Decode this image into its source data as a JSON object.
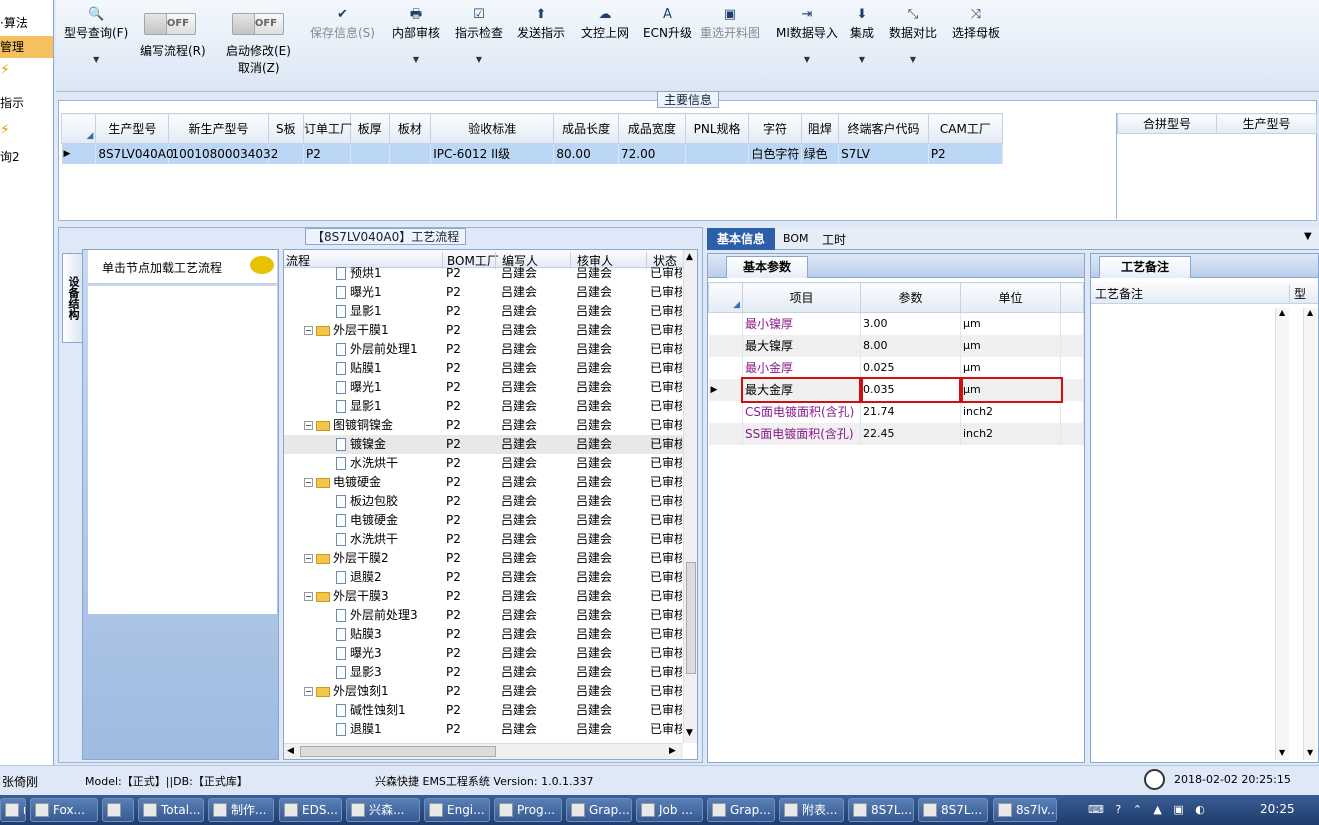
{
  "leftnav": {
    "items": [
      "·算法",
      "管理",
      "指示",
      "询2"
    ]
  },
  "toolbar": {
    "type_query": "型号查询(F)",
    "write_flow": "编写流程(R)",
    "start_modify": "启动修改(E)",
    "cancel": "取消(Z)",
    "toggle_off": "OFF",
    "save": "保存信息(S)",
    "internal_review": "内部审核",
    "instruction_check": "指示检查",
    "send_instruction": "发送指示",
    "upload": "文控上网",
    "ecn": "ECN升级",
    "reselect": "重选开料图",
    "mi_import": "MI数据导入",
    "integrate": "集成",
    "compare": "数据对比",
    "select_master": "选择母板"
  },
  "main_info": {
    "title": "主要信息",
    "columns": [
      "生产型号",
      "新生产型号",
      "S板",
      "订单工厂",
      "板厚",
      "板材",
      "验收标准",
      "成品长度",
      "成品宽度",
      "PNL规格",
      "字符",
      "阻焊",
      "终端客户代码",
      "CAM工厂"
    ],
    "row": [
      "8S7LV040A0",
      "10010800034032",
      "",
      "P2",
      "",
      "",
      "IPC-6012 II级",
      "80.00",
      "72.00",
      "",
      "白色字符",
      "绿色",
      "S7LV",
      "P2"
    ],
    "side_columns": [
      "合拼型号",
      "生产型号"
    ]
  },
  "equipment": {
    "tab": "设备结构",
    "hint": "单击节点加载工艺流程"
  },
  "flow": {
    "title": "【8S7LV040A0】工艺流程",
    "columns": [
      "流程",
      "BOM工厂",
      "编写人",
      "核审人",
      "状态"
    ],
    "rows": [
      {
        "name": "预烘1",
        "level": 2,
        "type": "doc",
        "factory": "P2",
        "writer": "吕建会",
        "reviewer": "吕建会",
        "status": "已审核"
      },
      {
        "name": "曝光1",
        "level": 2,
        "type": "doc",
        "factory": "P2",
        "writer": "吕建会",
        "reviewer": "吕建会",
        "status": "已审核"
      },
      {
        "name": "显影1",
        "level": 2,
        "type": "doc",
        "factory": "P2",
        "writer": "吕建会",
        "reviewer": "吕建会",
        "status": "已审核"
      },
      {
        "name": "外层干膜1",
        "level": 1,
        "type": "folder",
        "factory": "P2",
        "writer": "吕建会",
        "reviewer": "吕建会",
        "status": "已审核"
      },
      {
        "name": "外层前处理1",
        "level": 2,
        "type": "doc",
        "factory": "P2",
        "writer": "吕建会",
        "reviewer": "吕建会",
        "status": "已审核"
      },
      {
        "name": "贴膜1",
        "level": 2,
        "type": "doc",
        "factory": "P2",
        "writer": "吕建会",
        "reviewer": "吕建会",
        "status": "已审核"
      },
      {
        "name": "曝光1",
        "level": 2,
        "type": "doc",
        "factory": "P2",
        "writer": "吕建会",
        "reviewer": "吕建会",
        "status": "已审核"
      },
      {
        "name": "显影1",
        "level": 2,
        "type": "doc",
        "factory": "P2",
        "writer": "吕建会",
        "reviewer": "吕建会",
        "status": "已审核"
      },
      {
        "name": "图镀铜镍金",
        "level": 1,
        "type": "folder",
        "factory": "P2",
        "writer": "吕建会",
        "reviewer": "吕建会",
        "status": "已审核"
      },
      {
        "name": "镀镍金",
        "level": 2,
        "type": "doc",
        "factory": "P2",
        "writer": "吕建会",
        "reviewer": "吕建会",
        "status": "已审核",
        "selected": true
      },
      {
        "name": "水洗烘干",
        "level": 2,
        "type": "doc",
        "factory": "P2",
        "writer": "吕建会",
        "reviewer": "吕建会",
        "status": "已审核"
      },
      {
        "name": "电镀硬金",
        "level": 1,
        "type": "folder",
        "factory": "P2",
        "writer": "吕建会",
        "reviewer": "吕建会",
        "status": "已审核"
      },
      {
        "name": "板边包胶",
        "level": 2,
        "type": "doc",
        "factory": "P2",
        "writer": "吕建会",
        "reviewer": "吕建会",
        "status": "已审核"
      },
      {
        "name": "电镀硬金",
        "level": 2,
        "type": "doc",
        "factory": "P2",
        "writer": "吕建会",
        "reviewer": "吕建会",
        "status": "已审核"
      },
      {
        "name": "水洗烘干",
        "level": 2,
        "type": "doc",
        "factory": "P2",
        "writer": "吕建会",
        "reviewer": "吕建会",
        "status": "已审核"
      },
      {
        "name": "外层干膜2",
        "level": 1,
        "type": "folder",
        "factory": "P2",
        "writer": "吕建会",
        "reviewer": "吕建会",
        "status": "已审核"
      },
      {
        "name": "退膜2",
        "level": 2,
        "type": "doc",
        "factory": "P2",
        "writer": "吕建会",
        "reviewer": "吕建会",
        "status": "已审核"
      },
      {
        "name": "外层干膜3",
        "level": 1,
        "type": "folder",
        "factory": "P2",
        "writer": "吕建会",
        "reviewer": "吕建会",
        "status": "已审核"
      },
      {
        "name": "外层前处理3",
        "level": 2,
        "type": "doc",
        "factory": "P2",
        "writer": "吕建会",
        "reviewer": "吕建会",
        "status": "已审核"
      },
      {
        "name": "贴膜3",
        "level": 2,
        "type": "doc",
        "factory": "P2",
        "writer": "吕建会",
        "reviewer": "吕建会",
        "status": "已审核"
      },
      {
        "name": "曝光3",
        "level": 2,
        "type": "doc",
        "factory": "P2",
        "writer": "吕建会",
        "reviewer": "吕建会",
        "status": "已审核"
      },
      {
        "name": "显影3",
        "level": 2,
        "type": "doc",
        "factory": "P2",
        "writer": "吕建会",
        "reviewer": "吕建会",
        "status": "已审核"
      },
      {
        "name": "外层蚀刻1",
        "level": 1,
        "type": "folder",
        "factory": "P2",
        "writer": "吕建会",
        "reviewer": "吕建会",
        "status": "已审核"
      },
      {
        "name": "碱性蚀刻1",
        "level": 2,
        "type": "doc",
        "factory": "P2",
        "writer": "吕建会",
        "reviewer": "吕建会",
        "status": "已审核"
      },
      {
        "name": "退膜1",
        "level": 2,
        "type": "doc",
        "factory": "P2",
        "writer": "吕建会",
        "reviewer": "吕建会",
        "status": "已审核"
      }
    ]
  },
  "tabs": {
    "basic": "基本信息",
    "bom": "BOM",
    "hours": "工时"
  },
  "params": {
    "tab": "基本参数",
    "columns": [
      "项目",
      "参数",
      "单位"
    ],
    "rows": [
      {
        "item": "最小镍厚",
        "value": "3.00",
        "unit": "μm",
        "highlight": true
      },
      {
        "item": "最大镍厚",
        "value": "8.00",
        "unit": "μm",
        "highlight": false
      },
      {
        "item": "最小金厚",
        "value": "0.025",
        "unit": "μm",
        "highlight": true
      },
      {
        "item": "最大金厚",
        "value": "0.035",
        "unit": "μm",
        "highlight": false,
        "current": true
      },
      {
        "item": "CS面电镀面积(含孔)",
        "value": "21.74",
        "unit": "inch2",
        "highlight": true
      },
      {
        "item": "SS面电镀面积(含孔)",
        "value": "22.45",
        "unit": "inch2",
        "highlight": true
      }
    ]
  },
  "remarks": {
    "tab": "工艺备注",
    "col1": "工艺备注",
    "col2": "型"
  },
  "status": {
    "user": "张倚刚",
    "model": "Model:【正式】||DB:【正式库】",
    "system": "兴森快捷 EMS工程系统 Version: 1.0.1.337",
    "datetime": "2018-02-02 20:25:15"
  },
  "taskbar": {
    "items": [
      "ne...",
      "Fox...",
      "",
      "Total...",
      "制作...",
      "EDS...",
      "兴森...",
      "Engi...",
      "Prog...",
      "Grap...",
      "Job ...",
      "Grap...",
      "附表...",
      "8S7L...",
      "8S7L...",
      "8s7lv..."
    ],
    "clock": "20:25"
  }
}
